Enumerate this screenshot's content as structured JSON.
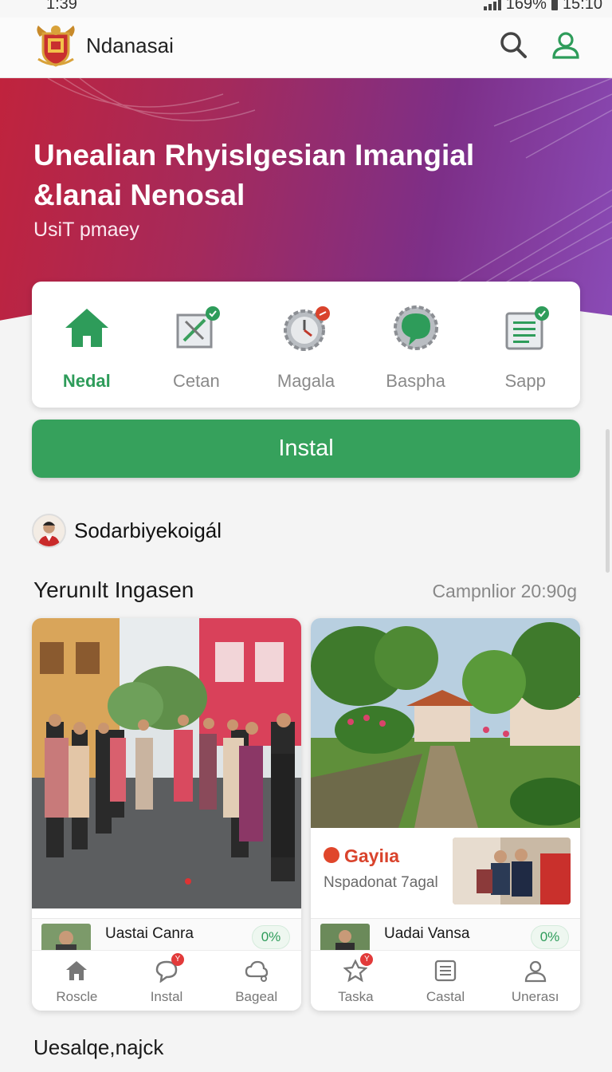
{
  "status_bar": {
    "time": "1:39",
    "battery": "169%",
    "clock_right": "15:10"
  },
  "header": {
    "app_name": "Ndanasai",
    "logo_icon": "crest-logo",
    "search_icon": "search-icon",
    "profile_icon": "user-icon"
  },
  "hero": {
    "title": "Unealian Rhyislgesian Imangial &lanai Nenosal",
    "subtitle": "UsiT pmaey"
  },
  "quick_actions": [
    {
      "label": "Nedal",
      "icon": "home-icon",
      "active": true
    },
    {
      "label": "Cetan",
      "icon": "edit-document-icon"
    },
    {
      "label": "Magala",
      "icon": "clock-gear-icon"
    },
    {
      "label": "Baspha",
      "icon": "chat-gear-icon"
    },
    {
      "label": "Sapp",
      "icon": "list-document-icon"
    }
  ],
  "install_button": {
    "label": "Instal"
  },
  "profile": {
    "name": "Sodarbiyekoigál"
  },
  "section": {
    "title": "Yerunılt Ingasen",
    "meta": "Campnlior 20:90g"
  },
  "card_left": {
    "mini_title": "Uastai Canra",
    "badge": "0%",
    "tabs": [
      {
        "label": "Roscle",
        "icon": "home-icon"
      },
      {
        "label": "Instal",
        "icon": "chat-bubble-icon",
        "badge": "Y"
      },
      {
        "label": "Bageal",
        "icon": "cloud-chat-icon"
      }
    ]
  },
  "card_right": {
    "promo_title": "Gayiıa",
    "promo_sub": "Nspadonat 7agal",
    "mini_title": "Uadai Vansa",
    "badge": "0%",
    "tabs": [
      {
        "label": "Taska",
        "icon": "star-chat-icon",
        "badge": "Y"
      },
      {
        "label": "Castal",
        "icon": "list-icon"
      },
      {
        "label": "Unerası",
        "icon": "user-icon"
      }
    ]
  },
  "footer": {
    "title": "Uesalqe,najck"
  },
  "colors": {
    "primary_green": "#36a15c",
    "hero_start": "#c0233d",
    "hero_end": "#8a4bb6",
    "promo_red": "#d9432c"
  }
}
